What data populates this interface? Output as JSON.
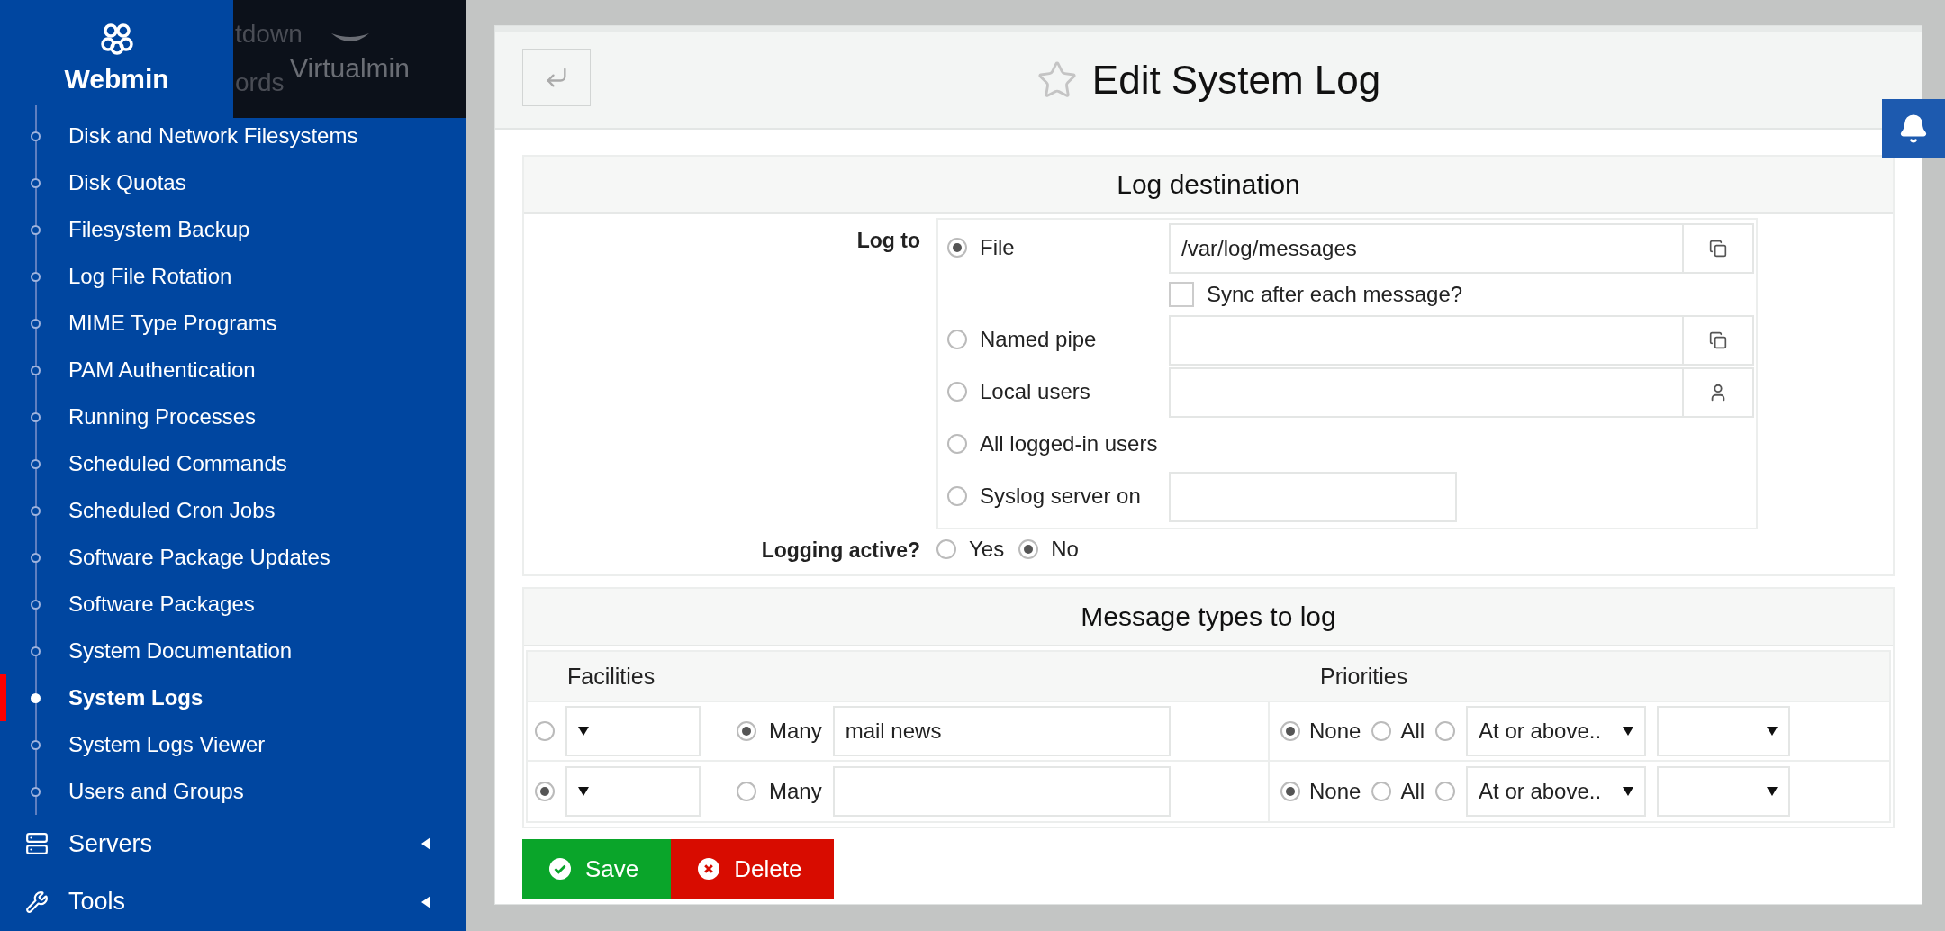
{
  "header": {
    "tabs": [
      {
        "label": "Webmin",
        "selected": true
      },
      {
        "label": "Virtualmin",
        "selected": false
      }
    ],
    "ghost_texts": [
      "tdown",
      "ords"
    ]
  },
  "sidebar": {
    "items": [
      {
        "label": "Disk and Network Filesystems",
        "selected": false
      },
      {
        "label": "Disk Quotas",
        "selected": false
      },
      {
        "label": "Filesystem Backup",
        "selected": false
      },
      {
        "label": "Log File Rotation",
        "selected": false
      },
      {
        "label": "MIME Type Programs",
        "selected": false
      },
      {
        "label": "PAM Authentication",
        "selected": false
      },
      {
        "label": "Running Processes",
        "selected": false
      },
      {
        "label": "Scheduled Commands",
        "selected": false
      },
      {
        "label": "Scheduled Cron Jobs",
        "selected": false
      },
      {
        "label": "Software Package Updates",
        "selected": false
      },
      {
        "label": "Software Packages",
        "selected": false
      },
      {
        "label": "System Documentation",
        "selected": false
      },
      {
        "label": "System Logs",
        "selected": true
      },
      {
        "label": "System Logs Viewer",
        "selected": false
      },
      {
        "label": "Users and Groups",
        "selected": false
      }
    ],
    "categories": [
      {
        "label": "Servers",
        "kind": "servers"
      },
      {
        "label": "Tools",
        "kind": "tools"
      }
    ]
  },
  "page": {
    "title": "Edit System Log"
  },
  "log_destination": {
    "title": "Log destination",
    "label": "Log to",
    "options": [
      {
        "kind": "file",
        "label": "File",
        "selected": true,
        "value": "/var/log/messages",
        "checkbox": {
          "label": "Sync after each message?",
          "checked": false
        }
      },
      {
        "kind": "file",
        "label": "Named pipe",
        "selected": false
      },
      {
        "kind": "users",
        "label": "Local users",
        "selected": false
      },
      {
        "kind": "plain",
        "label": "All logged-in users",
        "selected": false
      },
      {
        "kind": "host",
        "label": "Syslog server on",
        "selected": false
      }
    ],
    "logging_active": {
      "label": "Logging active?",
      "options": [
        {
          "label": "Yes",
          "selected": false
        },
        {
          "label": "No",
          "selected": true
        }
      ]
    }
  },
  "message_types": {
    "title": "Message types to log",
    "columns": [
      "Facilities",
      "Priorities"
    ],
    "rows": [
      {
        "one": {
          "selected": false
        },
        "many": {
          "label": "Many",
          "selected": true,
          "value": "mail news"
        },
        "priorities": [
          {
            "kind": "label",
            "label": "None",
            "selected": true
          },
          {
            "kind": "label",
            "label": "All",
            "selected": false
          },
          {
            "kind": "select",
            "value": "At or above..",
            "selected": false
          }
        ]
      },
      {
        "one": {
          "selected": true
        },
        "many": {
          "label": "Many",
          "selected": false
        },
        "priorities": [
          {
            "kind": "label",
            "label": "None",
            "selected": true
          },
          {
            "kind": "label",
            "label": "All",
            "selected": false
          },
          {
            "kind": "select",
            "value": "At or above..",
            "selected": false
          }
        ]
      }
    ]
  },
  "buttons": [
    {
      "kind": "save",
      "label": "Save"
    },
    {
      "kind": "delete",
      "label": "Delete"
    }
  ]
}
